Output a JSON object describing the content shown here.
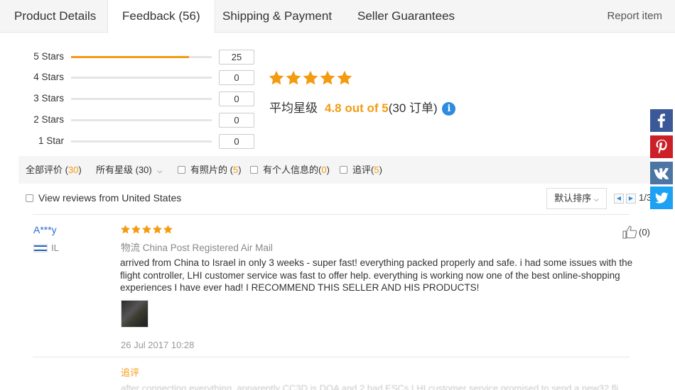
{
  "tabs": [
    {
      "label": "Product Details"
    },
    {
      "label": "Feedback (56)"
    },
    {
      "label": "Shipping & Payment"
    },
    {
      "label": "Seller Guarantees"
    }
  ],
  "report_label": "Report item",
  "distribution": [
    {
      "label": "5 Stars",
      "count": "25",
      "fraction": 0.84
    },
    {
      "label": "4 Stars",
      "count": "0",
      "fraction": 0
    },
    {
      "label": "3 Stars",
      "count": "0",
      "fraction": 0
    },
    {
      "label": "2 Stars",
      "count": "0",
      "fraction": 0
    },
    {
      "label": "1 Star",
      "count": "0",
      "fraction": 0
    }
  ],
  "average": {
    "prefix": "平均星级",
    "value": "4.8 out of 5",
    "orders": "(30 订单)",
    "info_icon": "info-icon",
    "stars": 5
  },
  "filters": {
    "all_prefix": "全部评价 (",
    "all_count": "30",
    "all_suffix": ")",
    "rating_select": "所有星级 (30)",
    "photos_prefix": "有照片的 (",
    "photos_count": "5",
    "personal_prefix": "有个人信息的(",
    "personal_count": "0",
    "followup_prefix": "追评(",
    "followup_count": "5",
    "close": ")"
  },
  "us_reviews_label": "View reviews from United States",
  "sort_label": "默认排序",
  "pagination": "1/3",
  "review": {
    "name": "A***y",
    "country": "IL",
    "stars": 5,
    "shipping_prefix": "物流",
    "shipping": "China Post Registered Air Mail",
    "text": "arrived from China to Israel in only 3 weeks - super fast! everything packed properly and safe. i had some issues with the flight controller, LHI customer service was fast to offer help. everything is working now one of the best online-shopping experiences I have ever had! I RECOMMEND THIS SELLER AND HIS PRODUCTS!",
    "date": "26 Jul 2017 10:28",
    "likes": "(0)",
    "followup_label": "追评",
    "followup_text": "after connecting everything, apparently CC3D is DOA and 2 bad ESCs LHI customer service promised to send a new32 fli"
  },
  "social": [
    {
      "name": "facebook",
      "color": "#3b5998",
      "glyph": "f"
    },
    {
      "name": "pinterest",
      "color": "#cb2027",
      "glyph": "p"
    },
    {
      "name": "vk",
      "color": "#4c75a3",
      "glyph": "vk"
    },
    {
      "name": "twitter",
      "color": "#1da1f2",
      "glyph": "t"
    }
  ],
  "colors": {
    "accent": "#f39c12",
    "link": "#2d6ccd",
    "info": "#2d8be0"
  }
}
